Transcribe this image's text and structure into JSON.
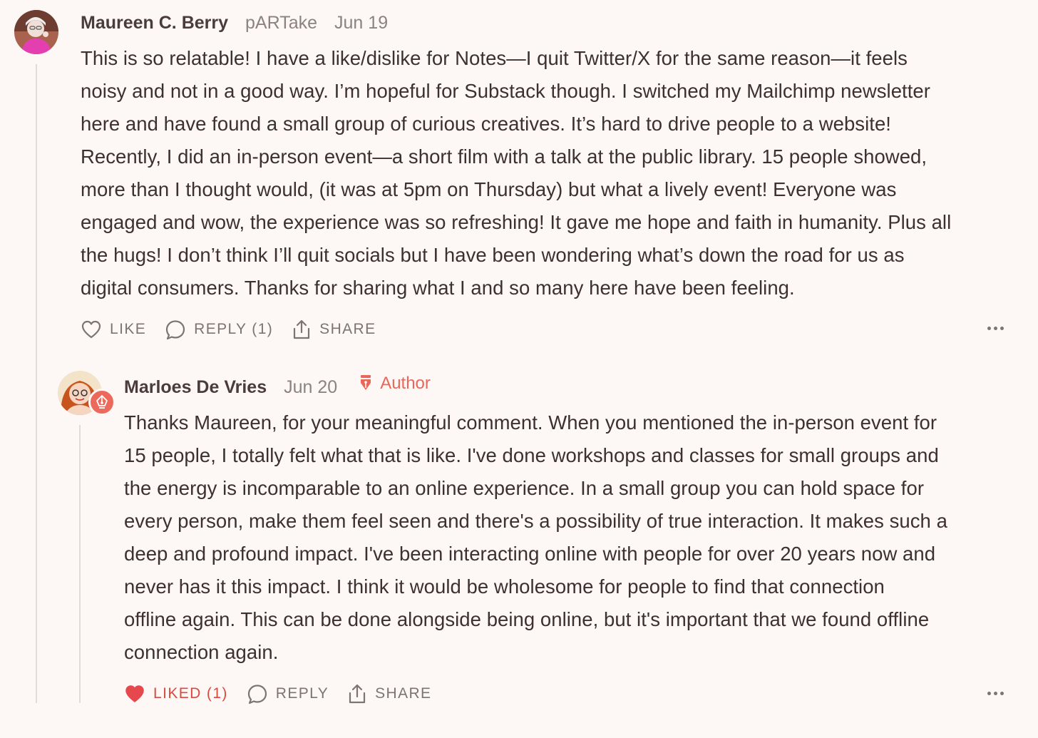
{
  "comment": {
    "author": "Maureen C. Berry",
    "publication": "pARTake",
    "date": "Jun 19",
    "lines": [
      "This is so relatable! I have a like/dislike for Notes—I quit Twitter/X for the same reason—it feels",
      "noisy and not in a good way. I’m hopeful for Substack though. I switched my Mailchimp newsletter",
      "here and have found a small group of curious creatives. It’s hard to drive people to a website!",
      "Recently, I did an in-person event—a short film with a talk at the public library. 15 people showed,",
      "more than I thought would, (it was at 5pm on Thursday) but what a lively event! Everyone was",
      "engaged and wow, the experience was so refreshing! It gave me hope and faith in humanity. Plus all",
      "the hugs! I don’t think I’ll quit socials but I have been wondering what’s down the road for us as",
      "digital consumers. Thanks for sharing what I and so many here have been feeling."
    ],
    "actions": {
      "like": "LIKE",
      "reply": "REPLY (1)",
      "share": "SHARE"
    },
    "icons": {
      "like": "heart-outline-icon",
      "reply": "speech-bubble-icon",
      "share": "share-icon",
      "more": "more-dots-icon"
    }
  },
  "reply": {
    "author": "Marloes De Vries",
    "date": "Jun 20",
    "badge": "Author",
    "lines": [
      "Thanks Maureen, for your meaningful comment. When you mentioned the in-person event for",
      "15 people, I totally felt what that is like. I've done workshops and classes for small groups and",
      "the energy is incomparable to an online experience. In a small group you can hold space for",
      "every person, make them feel seen and there's a possibility of true interaction. It makes such a",
      "deep and profound impact. I've been interacting online with people for over 20 years now and",
      "never has it this impact. I think it would be wholesome for people to find that connection",
      "offline again. This can be done alongside being online, but it's important that we found offline",
      "connection again."
    ],
    "actions": {
      "like": "LIKED (1)",
      "reply": "REPLY",
      "share": "SHARE"
    },
    "icons": {
      "like": "heart-filled-icon",
      "reply": "speech-bubble-icon",
      "share": "share-icon",
      "more": "more-dots-icon",
      "badge": "pen-nib-icon"
    }
  },
  "colors": {
    "background": "#fdf8f6",
    "accent": "#e8675a",
    "liked": "#d94a3e",
    "text": "#3d3030",
    "muted": "#8c8282"
  }
}
